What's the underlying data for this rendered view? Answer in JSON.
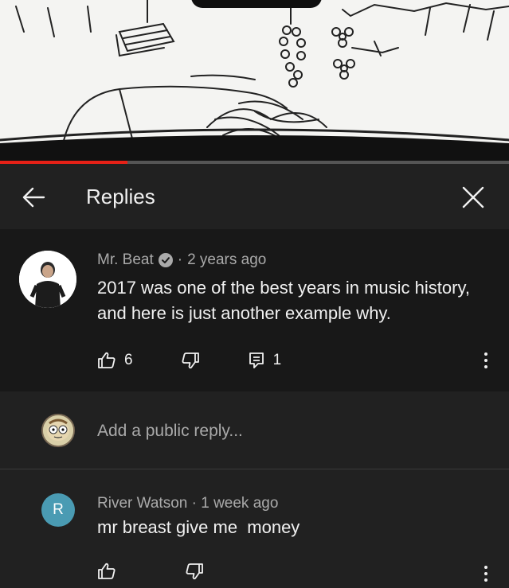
{
  "video": {
    "progress_fraction": 0.25
  },
  "header": {
    "title": "Replies",
    "back_icon": "arrow-left-icon",
    "close_icon": "close-icon"
  },
  "comment": {
    "author": "Mr. Beat",
    "verified_icon": "verified-check-icon",
    "separator": "·",
    "time": "2 years ago",
    "text": "2017 was one of the best years in music history, and here is just another example why.",
    "likes": "6",
    "replies": "1",
    "like_icon": "thumbs-up-icon",
    "dislike_icon": "thumbs-down-icon",
    "reply_icon": "reply-icon",
    "more_icon": "more-vert-icon"
  },
  "add_reply": {
    "placeholder": "Add a public reply..."
  },
  "reply": {
    "avatar_letter": "R",
    "avatar_color": "#4a9bb3",
    "author": "River Watson",
    "separator": "·",
    "time": "1 week ago",
    "text": "mr breast give me  money"
  },
  "colors": {
    "background": "#212121",
    "comment_background": "#181818",
    "secondary_text": "#aaaaaa",
    "primary_text": "#f1f1f1",
    "progress_red": "#e62117"
  }
}
